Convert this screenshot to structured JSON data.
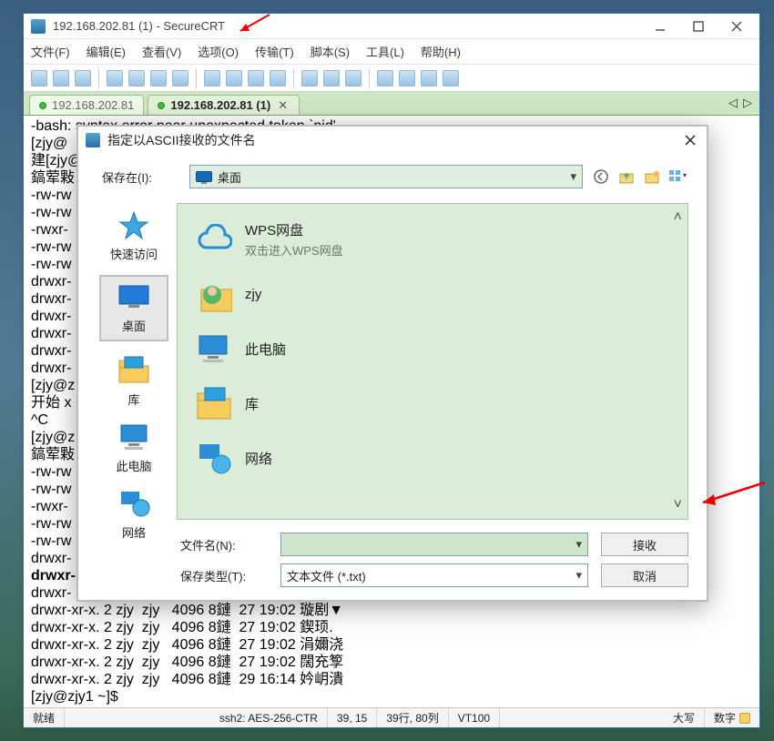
{
  "window": {
    "title": "192.168.202.81 (1) - SecureCRT"
  },
  "menu": {
    "file": "文件(F)",
    "edit": "编辑(E)",
    "view": "查看(V)",
    "options": "选项(O)",
    "transfer": "传输(T)",
    "script": "脚本(S)",
    "tools": "工具(L)",
    "help": "帮助(H)"
  },
  "tabs": {
    "inactive": "192.168.202.81",
    "active": "192.168.202.81 (1)"
  },
  "terminal_top": [
    "-bash: syntax error near unexpected token `nid'",
    "[zjy@",
    "建[zjy@",
    "鎬荤敤",
    "-rw-rw",
    "-rw-rw",
    "-rwxr-",
    "-rw-rw",
    "-rw-rw",
    "drwxr-",
    "drwxr-",
    "drwxr-",
    "drwxr-",
    "drwxr-",
    "drwxr-",
    "[zjy@z",
    "开始 x",
    "",
    "^C",
    "[zjy@z",
    "鎬荤敤",
    "-rw-rw",
    "-rw-rw",
    "-rwxr-",
    "-rw-rw",
    "-rw-rw",
    "drwxr-"
  ],
  "terminal_bold": "drwxr-",
  "terminal_bottom": [
    "drwxr-",
    "drwxr-xr-x. 2 zjy  zjy   4096 8鏈  27 19:02 璇剧▼",
    "drwxr-xr-x. 2 zjy  zjy   4096 8鏈  27 19:02 鍥顼.",
    "drwxr-xr-x. 2 zjy  zjy   4096 8鏈  27 19:02 涓嬭浇",
    "drwxr-xr-x. 2 zjy  zjy   4096 8鏈  27 19:02 闊充箰",
    "drwxr-xr-x. 2 zjy  zjy   4096 8鏈  29 16:14 妗岄潰",
    "[zjy@zjy1 ~]$ "
  ],
  "status": {
    "ready": "就绪",
    "proto": "ssh2: AES-256-CTR",
    "pos": "39, 15",
    "size": "39行, 80列",
    "term": "VT100",
    "caps": "大写",
    "num": "数字"
  },
  "dialog": {
    "title": "指定以ASCII接收的文件名",
    "savein_label": "保存在(I):",
    "location": "桌面",
    "places": {
      "quick": "快速访问",
      "desktop": "桌面",
      "libs": "库",
      "pc": "此电脑",
      "network": "网络"
    },
    "entries": {
      "wps_name": "WPS网盘",
      "wps_sub": "双击进入WPS网盘",
      "zjy": "zjy",
      "pc": "此电脑",
      "libs": "库",
      "network": "网络"
    },
    "filename_label": "文件名(N):",
    "filetype_label": "保存类型(T):",
    "filetype_value": "文本文件 (*.txt)",
    "accept_btn": "接收",
    "cancel_btn": "取消"
  }
}
